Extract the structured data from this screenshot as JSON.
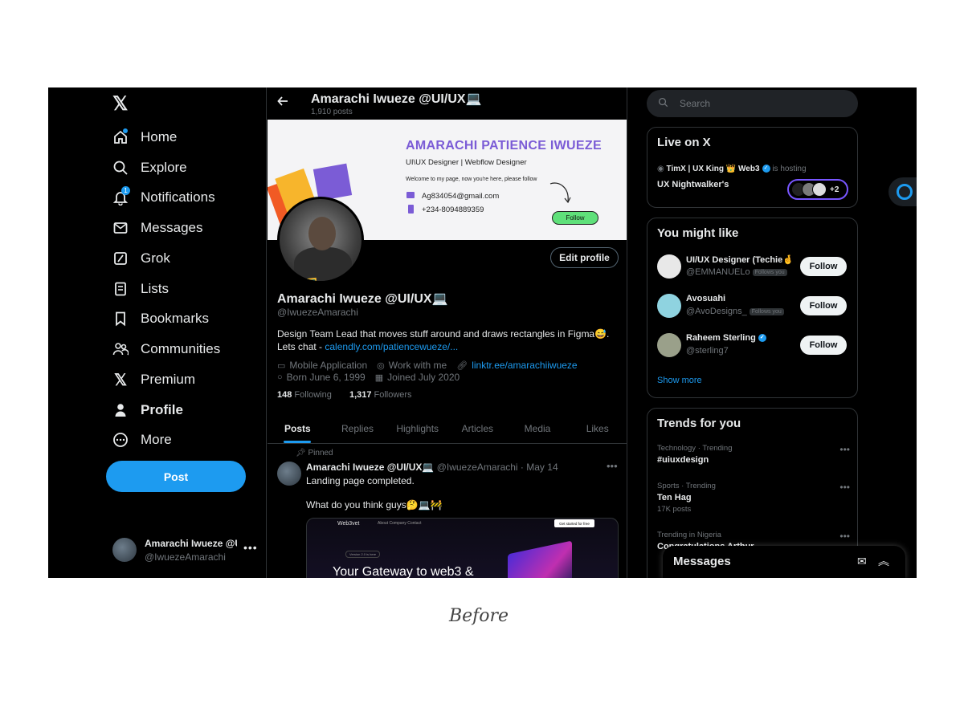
{
  "nav": {
    "items": [
      {
        "label": "Home",
        "icon": "home-icon"
      },
      {
        "label": "Explore",
        "icon": "search-icon"
      },
      {
        "label": "Notifications",
        "icon": "bell-icon",
        "badge": "1"
      },
      {
        "label": "Messages",
        "icon": "envelope-icon"
      },
      {
        "label": "Grok",
        "icon": "grok-icon"
      },
      {
        "label": "Lists",
        "icon": "list-icon"
      },
      {
        "label": "Bookmarks",
        "icon": "bookmark-icon"
      },
      {
        "label": "Communities",
        "icon": "people-icon"
      },
      {
        "label": "Premium",
        "icon": "x-logo-icon"
      },
      {
        "label": "Profile",
        "icon": "person-icon"
      },
      {
        "label": "More",
        "icon": "more-circle-icon"
      }
    ],
    "post_label": "Post",
    "account": {
      "name": "Amarachi Iwueze @UI/UX💻",
      "handle": "@IwuezeAmarachi"
    }
  },
  "header": {
    "title": "Amarachi Iwueze @UI/UX💻",
    "posts_count": "1,910 posts"
  },
  "banner": {
    "name": "AMARACHI PATIENCE IWUEZE",
    "role": "UI\\UX Designer | Webflow Designer",
    "welcome": "Welcome to my page, now you're here, please follow",
    "email": "Ag834054@gmail.com",
    "phone": "+234-8094889359",
    "follow": "Follow"
  },
  "profile": {
    "edit_label": "Edit profile",
    "name": "Amarachi Iwueze @UI/UX💻",
    "handle": "@IwuezeAmarachi",
    "bio": "Design Team Lead that moves stuff around and draws rectangles in Figma😅. Lets chat - ",
    "bio_link": "calendly.com/patiencewueze/...",
    "category": "Mobile Application",
    "location": "Work with me",
    "website": "linktr.ee/amarachiiwueze",
    "born": "Born June 6, 1999",
    "joined": "Joined July 2020",
    "following_count": "148",
    "following_label": "Following",
    "followers_count": "1,317",
    "followers_label": "Followers"
  },
  "tabs": [
    "Posts",
    "Replies",
    "Highlights",
    "Articles",
    "Media",
    "Likes"
  ],
  "tweet": {
    "pinned_label": "Pinned",
    "author": "Amarachi Iwueze @UI/UX💻",
    "handle": "@IwuezeAmarachi",
    "date": "May 14",
    "text1": "Landing page completed.",
    "text2": "What do you think guys🤔💻🚧",
    "media": {
      "logo": "Web3vet",
      "links": "About   Company   Contact",
      "cta": "Get started for free",
      "pill": "Version 2.0 is here",
      "headline": "Your Gateway to web3 &"
    }
  },
  "right": {
    "search_placeholder": "Search",
    "live": {
      "title": "Live on X",
      "host": "TimX | UX King 👑 Web3",
      "hosting": "is hosting",
      "space": "UX Nightwalker's",
      "extra": "+2"
    },
    "you_might_like": {
      "title": "You might like",
      "follow_label": "Follow",
      "follows_you": "Follows you",
      "users": [
        {
          "name": "UI/UX Designer (Techie🤞",
          "handle": "@EMMANUELo",
          "follows_you": true,
          "verified": false
        },
        {
          "name": "Avosuahi",
          "handle": "@AvoDesigns_",
          "follows_you": true,
          "verified": false
        },
        {
          "name": "Raheem Sterling",
          "handle": "@sterling7",
          "follows_you": false,
          "verified": true
        }
      ],
      "show_more": "Show more"
    },
    "trends": {
      "title": "Trends for you",
      "items": [
        {
          "context": "Technology · Trending",
          "topic": "#uiuxdesign",
          "posts": ""
        },
        {
          "context": "Sports · Trending",
          "topic": "Ten Hag",
          "posts": "17K posts"
        },
        {
          "context": "Trending in Nigeria",
          "topic": "Congratulations Arthur",
          "posts": ""
        }
      ]
    },
    "messages_title": "Messages"
  },
  "caption": "Before",
  "colors": {
    "accent": "#1d9bf0",
    "background": "#000000",
    "text": "#e7e9ea",
    "muted": "#71767b",
    "live_ring": "#7856ff"
  }
}
